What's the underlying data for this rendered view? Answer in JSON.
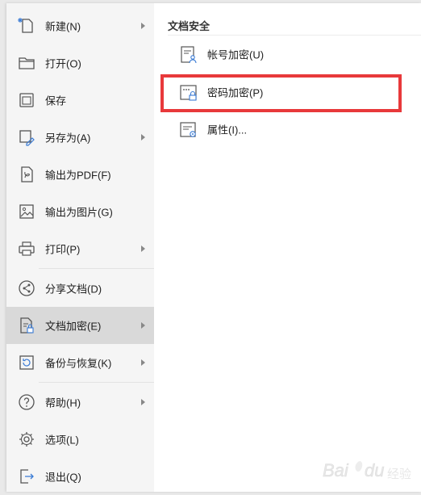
{
  "left_menu": {
    "items": [
      {
        "label": "新建(N)",
        "icon": "new-file-icon",
        "has_submenu": true
      },
      {
        "label": "打开(O)",
        "icon": "folder-open-icon",
        "has_submenu": false
      },
      {
        "label": "保存",
        "icon": "save-icon",
        "has_submenu": false
      },
      {
        "label": "另存为(A)",
        "icon": "save-as-icon",
        "has_submenu": true
      },
      {
        "label": "输出为PDF(F)",
        "icon": "export-pdf-icon",
        "has_submenu": false
      },
      {
        "label": "输出为图片(G)",
        "icon": "export-image-icon",
        "has_submenu": false
      },
      {
        "label": "打印(P)",
        "icon": "print-icon",
        "has_submenu": true
      },
      {
        "label": "分享文档(D)",
        "icon": "share-icon",
        "has_submenu": false
      },
      {
        "label": "文档加密(E)",
        "icon": "document-encrypt-icon",
        "has_submenu": true,
        "active": true
      },
      {
        "label": "备份与恢复(K)",
        "icon": "backup-restore-icon",
        "has_submenu": true
      },
      {
        "label": "帮助(H)",
        "icon": "help-icon",
        "has_submenu": true
      },
      {
        "label": "选项(L)",
        "icon": "settings-gear-icon",
        "has_submenu": false
      },
      {
        "label": "退出(Q)",
        "icon": "exit-icon",
        "has_submenu": false
      }
    ]
  },
  "submenu": {
    "title": "文档安全",
    "items": [
      {
        "label": "帐号加密(U)",
        "icon": "account-encrypt-icon"
      },
      {
        "label": "密码加密(P)",
        "icon": "password-encrypt-icon",
        "highlighted": true
      },
      {
        "label": "属性(I)...",
        "icon": "properties-icon"
      }
    ]
  },
  "colors": {
    "highlight_border": "#e8393b",
    "active_item_bg": "#d9d9d9",
    "menu_bg": "#f5f5f5"
  },
  "watermark": {
    "text": "Bai du 经验"
  }
}
